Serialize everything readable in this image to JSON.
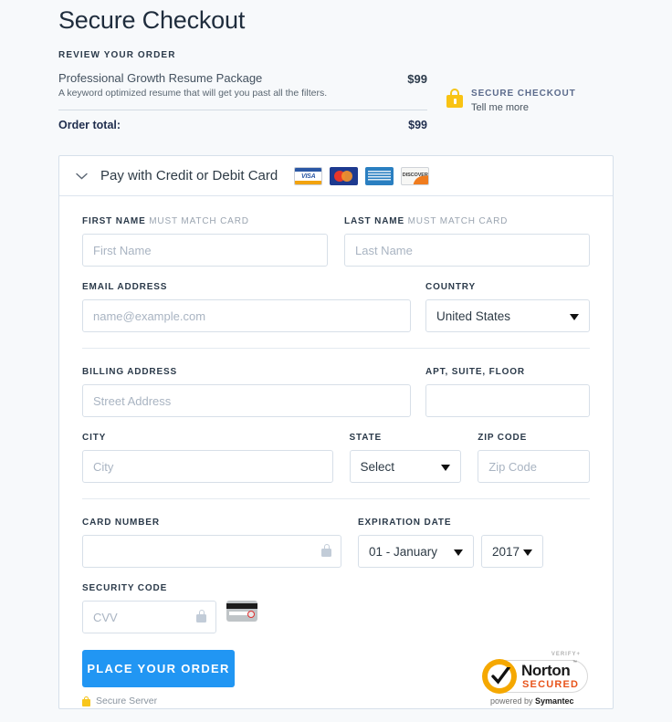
{
  "header": {
    "title": "Secure Checkout",
    "review_label": "REVIEW YOUR ORDER"
  },
  "order_summary": {
    "item_name": "Professional Growth Resume Package",
    "item_description": "A keyword optimized resume that will get you past all the filters.",
    "item_price": "$99",
    "total_label": "Order total:",
    "total_price": "$99"
  },
  "secure_badge": {
    "icon": "padlock-icon",
    "title": "SECURE CHECKOUT",
    "subtitle": "Tell me more"
  },
  "payment_card": {
    "header_title": "Pay with Credit or Debit Card",
    "chevron_icon": "chevron-down-icon",
    "accepted_cards": [
      {
        "name": "visa-logo",
        "label": "VISA"
      },
      {
        "name": "mastercard-logo",
        "label": ""
      },
      {
        "name": "amex-logo",
        "label": "AMERICAN EXPRESS"
      },
      {
        "name": "discover-logo",
        "label": "DISCOVER"
      }
    ]
  },
  "form": {
    "first_name": {
      "label": "FIRST NAME",
      "label_suffix": "MUST MATCH CARD",
      "placeholder": "First Name",
      "value": ""
    },
    "last_name": {
      "label": "LAST NAME",
      "label_suffix": "MUST MATCH CARD",
      "placeholder": "Last Name",
      "value": ""
    },
    "email": {
      "label": "EMAIL ADDRESS",
      "placeholder": "name@example.com",
      "value": ""
    },
    "country": {
      "label": "COUNTRY",
      "selected": "United States"
    },
    "billing_address": {
      "label": "BILLING ADDRESS",
      "placeholder": "Street Address",
      "value": ""
    },
    "apt": {
      "label": "APT, SUITE, FLOOR",
      "placeholder": "",
      "value": ""
    },
    "city": {
      "label": "CITY",
      "placeholder": "City",
      "value": ""
    },
    "state": {
      "label": "STATE",
      "selected": "Select"
    },
    "zip": {
      "label": "ZIP CODE",
      "placeholder": "Zip Code",
      "value": ""
    },
    "card_number": {
      "label": "CARD NUMBER",
      "placeholder": "",
      "value": "",
      "icon": "lock-icon"
    },
    "expiration": {
      "label": "EXPIRATION DATE",
      "month_selected": "01 - January",
      "year_selected": "2017"
    },
    "security_code": {
      "label": "SECURITY CODE",
      "placeholder": "CVV",
      "value": "",
      "icon": "lock-icon",
      "hint_icon": "card-back-icon"
    }
  },
  "footer": {
    "submit_label": "PLACE YOUR ORDER",
    "secure_server_label": "Secure Server",
    "secure_server_icon": "padlock-icon",
    "norton": {
      "verify": "VERIFY+",
      "brand": "Norton",
      "trademark": "™",
      "secured": "SECURED",
      "powered_prefix": "powered by ",
      "powered_brand": "Symantec"
    }
  },
  "colors": {
    "accent_blue": "#2196f3",
    "lock_yellow": "#f8c61c",
    "norton_orange": "#f5a800",
    "norton_secured": "#e8541b",
    "page_bg": "#f7f9fb"
  }
}
